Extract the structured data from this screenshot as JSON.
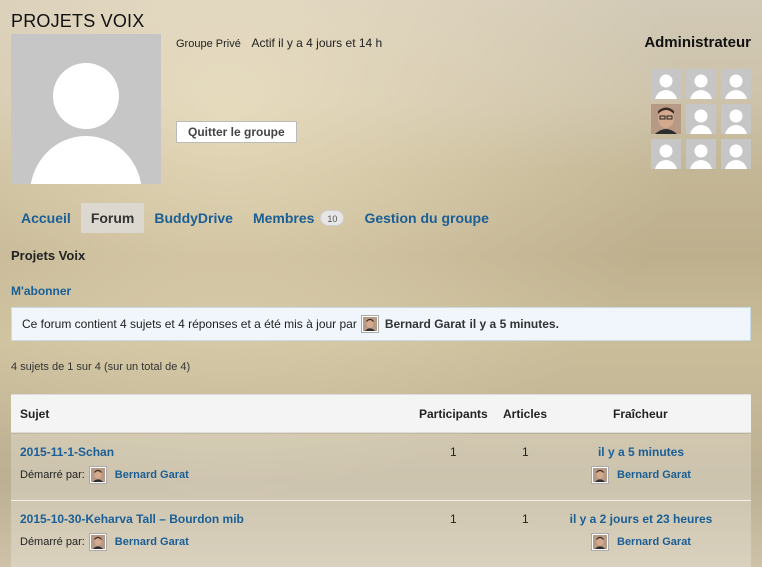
{
  "group": {
    "title": "PROJETS VOIX",
    "status": "Groupe Privé",
    "activity": "Actif il y a 4 jours et 14 h",
    "leave_label": "Quitter le groupe"
  },
  "admins": {
    "title": "Administrateur"
  },
  "tabs": [
    {
      "label": "Accueil"
    },
    {
      "label": "Forum"
    },
    {
      "label": "BuddyDrive"
    },
    {
      "label": "Membres",
      "count": "10"
    },
    {
      "label": "Gestion du groupe"
    }
  ],
  "forum": {
    "title": "Projets Voix",
    "subscribe_label": "M'abonner",
    "notice_text": "Ce forum contient 4 sujets et 4 réponses et a été mis à jour par",
    "notice_author": "Bernard Garat",
    "notice_time": "il y a 5 minutes.",
    "pagination": "4 sujets de 1 sur 4 (sur un total de 4)"
  },
  "table": {
    "headers": {
      "subject": "Sujet",
      "participants": "Participants",
      "articles": "Articles",
      "freshness": "Fraîcheur"
    },
    "rows": [
      {
        "title": "2015-11-1-Schan",
        "started_label": "Démarré par:",
        "author": "Bernard Garat",
        "participants": "1",
        "articles": "1",
        "fresh_time": "il y a 5 minutes",
        "fresh_author": "Bernard Garat"
      },
      {
        "title": "2015-10-30-Keharva Tall – Bourdon mib",
        "started_label": "Démarré par:",
        "author": "Bernard Garat",
        "participants": "1",
        "articles": "1",
        "fresh_time": "il y a 2 jours et 23 heures",
        "fresh_author": "Bernard Garat"
      }
    ]
  },
  "colors": {
    "link": "#1a5e96",
    "active_tab_bg": "#ddd8cf",
    "notice_bg": "#f0f6fb",
    "avatar_placeholder": "#c6c6c6"
  }
}
